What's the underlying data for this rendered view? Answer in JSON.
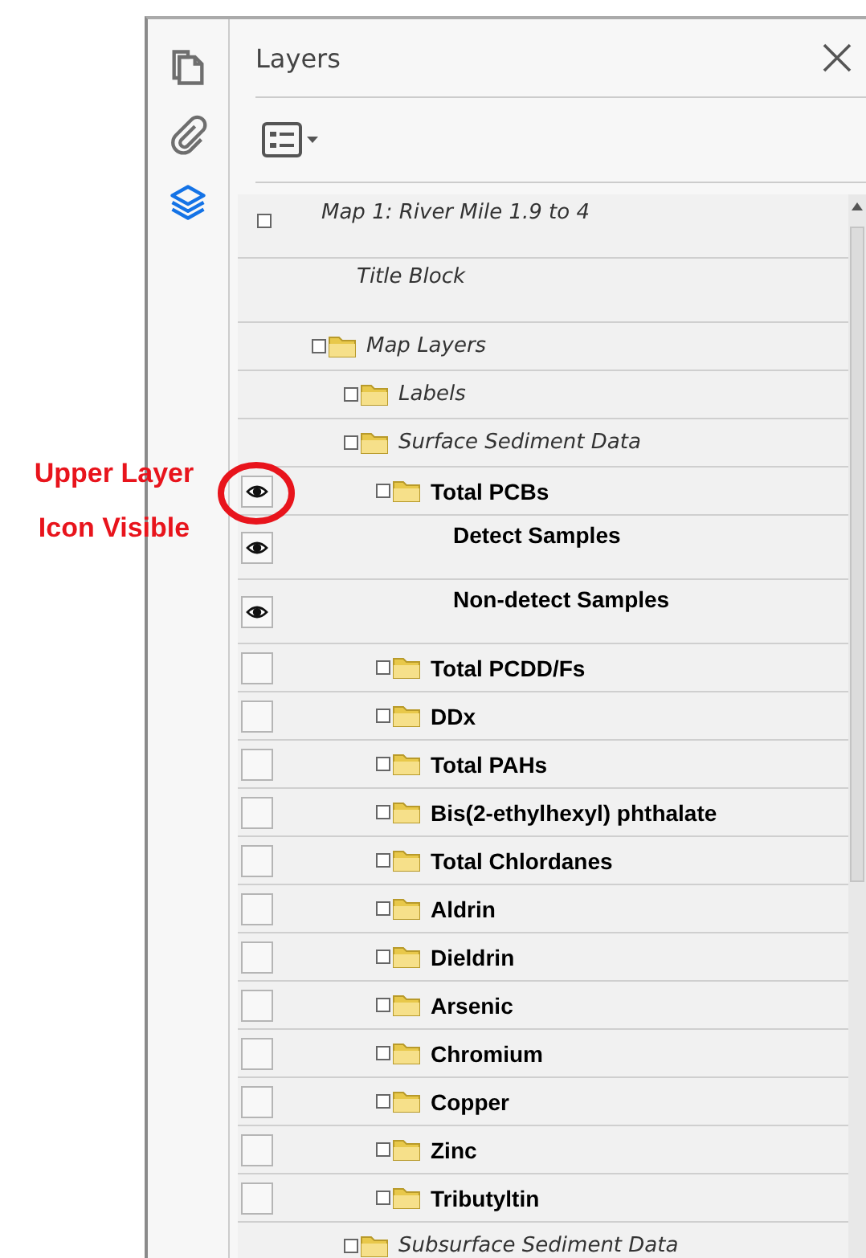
{
  "annotation": {
    "text": "Upper Layer Icon Visible"
  },
  "sidebar": {
    "tabs": [
      {
        "selected": false
      },
      {
        "selected": false
      },
      {
        "selected": true
      }
    ]
  },
  "panel": {
    "title": "Layers",
    "tree": [
      {
        "label": "Map 1: River Mile 1.9 to 4",
        "kind": "root",
        "children": [
          {
            "label": "Title Block",
            "kind": "layer"
          },
          {
            "label": "Map Layers",
            "kind": "group",
            "children": [
              {
                "label": "Labels",
                "kind": "group"
              },
              {
                "label": "Surface Sediment Data",
                "kind": "group",
                "children": [
                  {
                    "label": "Total PCBs",
                    "kind": "group",
                    "visible": true,
                    "children": [
                      {
                        "label": "Detect Samples",
                        "kind": "layer",
                        "visible": true
                      },
                      {
                        "label": "Non-detect Samples",
                        "kind": "layer",
                        "visible": true
                      }
                    ]
                  },
                  {
                    "label": "Total PCDD/Fs",
                    "kind": "group",
                    "visible": false
                  },
                  {
                    "label": "DDx",
                    "kind": "group",
                    "visible": false
                  },
                  {
                    "label": "Total PAHs",
                    "kind": "group",
                    "visible": false
                  },
                  {
                    "label": "Bis(2-ethylhexyl) phthalate",
                    "kind": "group",
                    "visible": false
                  },
                  {
                    "label": "Total Chlordanes",
                    "kind": "group",
                    "visible": false
                  },
                  {
                    "label": "Aldrin",
                    "kind": "group",
                    "visible": false
                  },
                  {
                    "label": "Dieldrin",
                    "kind": "group",
                    "visible": false
                  },
                  {
                    "label": "Arsenic",
                    "kind": "group",
                    "visible": false
                  },
                  {
                    "label": "Chromium",
                    "kind": "group",
                    "visible": false
                  },
                  {
                    "label": "Copper",
                    "kind": "group",
                    "visible": false
                  },
                  {
                    "label": "Zinc",
                    "kind": "group",
                    "visible": false
                  },
                  {
                    "label": "Tributyltin",
                    "kind": "group",
                    "visible": false
                  }
                ]
              },
              {
                "label": "Subsurface Sediment Data",
                "kind": "group"
              }
            ]
          }
        ]
      }
    ]
  }
}
